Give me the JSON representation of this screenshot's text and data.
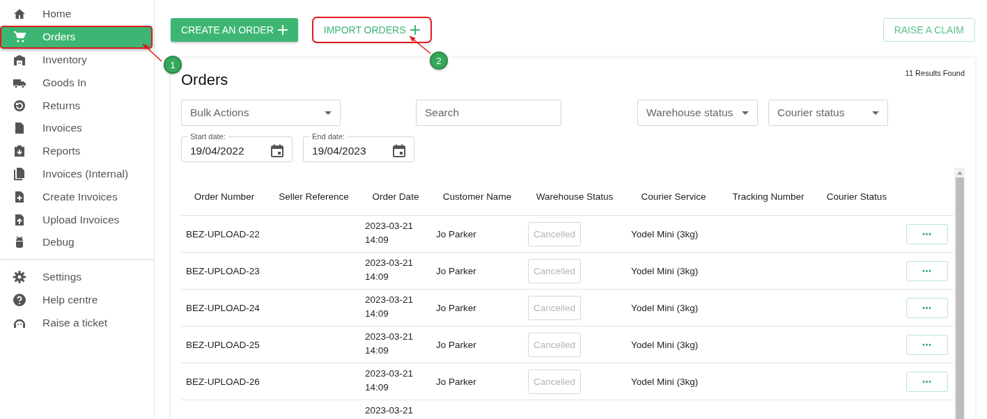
{
  "sidebar": {
    "sections": [
      {
        "items": [
          {
            "label": "Home",
            "selected": false,
            "highlighted": false
          },
          {
            "label": "Orders",
            "selected": true,
            "highlighted": true
          },
          {
            "label": "Inventory",
            "selected": false,
            "highlighted": false
          },
          {
            "label": "Goods In",
            "selected": false,
            "highlighted": false
          },
          {
            "label": "Returns",
            "selected": false,
            "highlighted": false
          },
          {
            "label": "Invoices",
            "selected": false,
            "highlighted": false
          },
          {
            "label": "Reports",
            "selected": false,
            "highlighted": false
          },
          {
            "label": "Invoices (Internal)",
            "selected": false,
            "highlighted": false
          },
          {
            "label": "Create Invoices",
            "selected": false,
            "highlighted": false
          },
          {
            "label": "Upload Invoices",
            "selected": false,
            "highlighted": false
          },
          {
            "label": "Debug",
            "selected": false,
            "highlighted": false
          }
        ]
      },
      {
        "items": [
          {
            "label": "Settings",
            "selected": false,
            "highlighted": false
          },
          {
            "label": "Help centre",
            "selected": false,
            "highlighted": false
          },
          {
            "label": "Raise a ticket",
            "selected": false,
            "highlighted": false
          }
        ]
      }
    ]
  },
  "toolbar": {
    "buttons": [
      {
        "label": "CREATE AN ORDER",
        "kind": "filled",
        "highlighted": false
      },
      {
        "label": "IMPORT ORDERS",
        "kind": "text",
        "highlighted": true
      },
      {
        "label": "RAISE A CLAIM",
        "kind": "outlined",
        "highlighted": false
      }
    ]
  },
  "annotations": [
    {
      "number": "1"
    },
    {
      "number": "2"
    }
  ],
  "panel": {
    "title": "Orders",
    "results": "11 Results Found",
    "filters": [
      {
        "kind": "select",
        "placeholder": "Bulk Actions"
      },
      {
        "kind": "search",
        "placeholder": "Search"
      },
      {
        "kind": "select",
        "placeholder": "Warehouse status"
      },
      {
        "kind": "select",
        "placeholder": "Courier status"
      }
    ],
    "dates": [
      {
        "label": "Start date:",
        "value": "19/04/2022"
      },
      {
        "label": "End date:",
        "value": "19/04/2023"
      }
    ],
    "table": {
      "columns": [
        "Order Number",
        "Seller Reference",
        "Order Date",
        "Customer Name",
        "Warehouse Status",
        "Courier Service",
        "Tracking Number",
        "Courier Status"
      ],
      "rows": [
        {
          "order_number": "BEZ-UPLOAD-22",
          "order_date": "2023-03-21 14:09",
          "customer_name": "Jo Parker",
          "warehouse_status": "Cancelled",
          "courier_service": "Yodel Mini (3kg)",
          "actions": "•••"
        },
        {
          "order_number": "BEZ-UPLOAD-23",
          "order_date": "2023-03-21 14:09",
          "customer_name": "Jo Parker",
          "warehouse_status": "Cancelled",
          "courier_service": "Yodel Mini (3kg)",
          "actions": "•••"
        },
        {
          "order_number": "BEZ-UPLOAD-24",
          "order_date": "2023-03-21 14:09",
          "customer_name": "Jo Parker",
          "warehouse_status": "Cancelled",
          "courier_service": "Yodel Mini (3kg)",
          "actions": "•••"
        },
        {
          "order_number": "BEZ-UPLOAD-25",
          "order_date": "2023-03-21 14:09",
          "customer_name": "Jo Parker",
          "warehouse_status": "Cancelled",
          "courier_service": "Yodel Mini (3kg)",
          "actions": "•••"
        },
        {
          "order_number": "BEZ-UPLOAD-26",
          "order_date": "2023-03-21 14:09",
          "customer_name": "Jo Parker",
          "warehouse_status": "Cancelled",
          "courier_service": "Yodel Mini (3kg)",
          "actions": "•••"
        },
        {
          "order_date": "2023-03-21"
        }
      ]
    }
  }
}
